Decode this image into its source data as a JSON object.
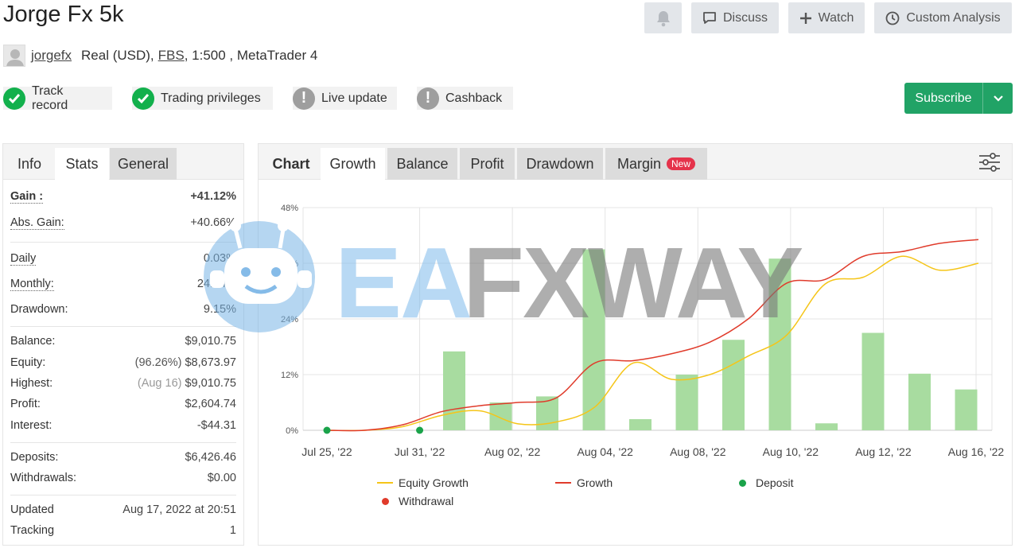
{
  "header": {
    "title": "Jorge Fx 5k",
    "bell_icon": "bell-icon",
    "discuss_label": "Discuss",
    "watch_label": "Watch",
    "custom_analysis_label": "Custom Analysis"
  },
  "account": {
    "username": "jorgefx",
    "type": "Real (USD),",
    "broker": "FBS",
    "details": ", 1:500 , MetaTrader 4"
  },
  "badges": [
    {
      "label": "Track record",
      "status": "verified"
    },
    {
      "label": "Trading privileges",
      "status": "verified"
    },
    {
      "label": "Live update",
      "status": "warning"
    },
    {
      "label": "Cashback",
      "status": "warning"
    }
  ],
  "subscribe_label": "Subscribe",
  "colors": {
    "accent_green": "#21a366",
    "check_green": "#12b04c",
    "warn_gray": "#9e9e9e",
    "equity_line": "#f5c518",
    "growth_line": "#e03b2b",
    "bar_fill": "#a8dca0",
    "new_badge": "#e5334b"
  },
  "info_panel": {
    "tabs": [
      "Info",
      "Stats",
      "General"
    ],
    "gain": {
      "label": "Gain :",
      "value": "+41.12%"
    },
    "abs_gain": {
      "label": "Abs. Gain:",
      "value": "+40.66%"
    },
    "daily": {
      "label": "Daily",
      "value": "0.03%"
    },
    "monthly": {
      "label": "Monthly:",
      "value": "24.74%"
    },
    "drawdown": {
      "label": "Drawdown:",
      "value": "9.15%"
    },
    "balance": {
      "label": "Balance:",
      "value": "$9,010.75"
    },
    "equity": {
      "label": "Equity:",
      "note": "(96.26%)",
      "value": "$8,673.97"
    },
    "highest": {
      "label": "Highest:",
      "note": "(Aug 16)",
      "value": "$9,010.75"
    },
    "profit": {
      "label": "Profit:",
      "value": "$2,604.74"
    },
    "interest": {
      "label": "Interest:",
      "value": "-$44.31"
    },
    "deposits": {
      "label": "Deposits:",
      "value": "$6,426.46"
    },
    "withdrawals": {
      "label": "Withdrawals:",
      "value": "$0.00"
    },
    "updated": {
      "label": "Updated",
      "value": "Aug 17, 2022 at 20:51"
    },
    "tracking": {
      "label": "Tracking",
      "value": "1"
    }
  },
  "chart_panel": {
    "tabs": [
      "Chart",
      "Growth",
      "Balance",
      "Profit",
      "Drawdown",
      "Margin"
    ],
    "new_badge": "New",
    "settings_icon": "sliders-icon"
  },
  "watermark": {
    "part1": "EA",
    "part2": "FXWAY"
  },
  "chart_data": {
    "type": "bar+line",
    "x_labels": [
      "Jul 25, '22",
      "Jul 31, '22",
      "Aug 02, '22",
      "Aug 04, '22",
      "Aug 08, '22",
      "Aug 10, '22",
      "Aug 12, '22",
      "Aug 16, '22"
    ],
    "y_ticks": [
      "0%",
      "12%",
      "24%",
      "36%",
      "48%"
    ],
    "ylim": [
      0,
      48
    ],
    "bars": [
      17,
      6,
      7.3,
      39,
      2.4,
      12,
      19.5,
      37,
      1.5,
      21,
      12.2,
      8.8
    ],
    "equity_growth": [
      0,
      0,
      0.8,
      3.2,
      4.2,
      1.4,
      1.8,
      5,
      14.5,
      11,
      12,
      16,
      20.5,
      31.5,
      33,
      37.5,
      34.5,
      36
    ],
    "growth": [
      0,
      0,
      1.2,
      4,
      5.3,
      6,
      7,
      14.5,
      15,
      16.5,
      19,
      24,
      31.7,
      32.5,
      37.5,
      38.5,
      40.3,
      41.1
    ],
    "deposits_at": [
      0,
      1
    ],
    "legend": [
      {
        "name": "Equity Growth",
        "marker": "line",
        "color": "#f5c518"
      },
      {
        "name": "Growth",
        "marker": "line",
        "color": "#e03b2b"
      },
      {
        "name": "Deposit",
        "marker": "dot",
        "color": "#1aa34a"
      },
      {
        "name": "Withdrawal",
        "marker": "dot",
        "color": "#e03b2b"
      }
    ]
  }
}
